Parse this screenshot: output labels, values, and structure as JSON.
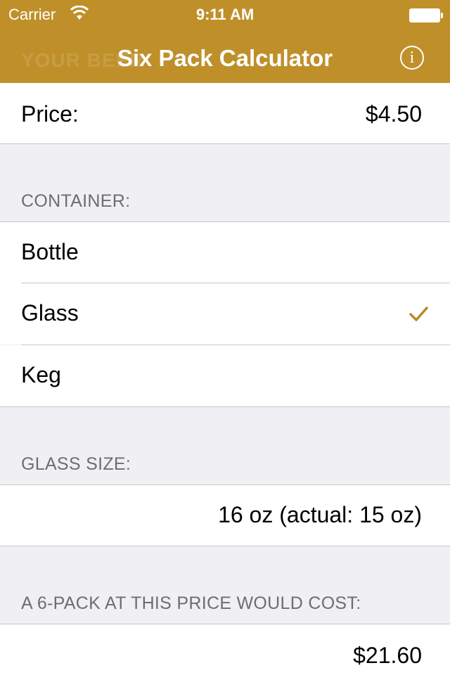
{
  "status_bar": {
    "carrier": "Carrier",
    "time": "9:11 AM"
  },
  "nav": {
    "title": "Six Pack Calculator",
    "info_icon": "info-icon",
    "ghost_text": "YOUR BEER"
  },
  "price_row": {
    "label": "Price:",
    "value": "$4.50"
  },
  "container_section": {
    "header": "CONTAINER:",
    "options": [
      {
        "label": "Bottle",
        "selected": false
      },
      {
        "label": "Glass",
        "selected": true
      },
      {
        "label": "Keg",
        "selected": false
      }
    ]
  },
  "glass_size_section": {
    "header": "GLASS SIZE:",
    "value": "16 oz (actual: 15 oz)"
  },
  "result_section": {
    "header": "A 6-PACK AT THIS PRICE WOULD COST:",
    "value": "$21.60"
  },
  "colors": {
    "nav_background": "#bf902a",
    "accent": "#b88a2a",
    "group_background": "#efeff4"
  }
}
